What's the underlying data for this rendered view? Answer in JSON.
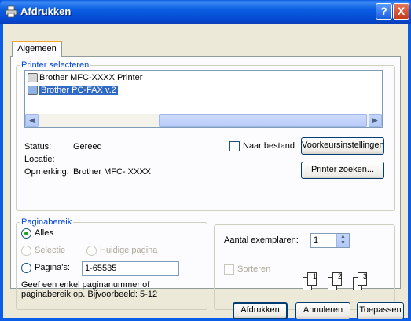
{
  "window": {
    "title": "Afdrukken",
    "help_glyph": "?",
    "close_glyph": "X"
  },
  "tabs": [
    {
      "label": "Algemeen"
    }
  ],
  "printer_group": {
    "legend": "Printer selecteren",
    "printers": [
      {
        "name": "Brother MFC-XXXX  Printer",
        "selected": false
      },
      {
        "name": "Brother PC-FAX v.2",
        "selected": true
      }
    ],
    "scroll_left": "◀",
    "scroll_right": "▶",
    "status_label": "Status:",
    "status_value": "Gereed",
    "location_label": "Locatie:",
    "location_value": "",
    "comment_label": "Opmerking:",
    "comment_value": "Brother MFC- XXXX",
    "print_to_file_label": "Naar bestand",
    "print_to_file_checked": false,
    "preferences_button": "Voorkeursinstellingen",
    "find_printer_button": "Printer zoeken..."
  },
  "page_range": {
    "legend": "Paginabereik",
    "all_label": "Alles",
    "selection_label": "Selectie",
    "current_page_label": "Huidige pagina",
    "pages_label": "Pagina's:",
    "pages_value": "1-65535",
    "help_line1": "Geef een enkel paginanummer of",
    "help_line2": "paginabereik op. Bijvoorbeeld: 5-12",
    "selected": "all"
  },
  "copies": {
    "count_label": "Aantal exemplaren:",
    "count_value": "1",
    "spin_up": "▲",
    "spin_down": "▼",
    "collate_label": "Sorteren",
    "collate_checked": false,
    "page_icons": [
      "1",
      "1",
      "2",
      "2",
      "3",
      "3"
    ]
  },
  "footer": {
    "print_button": "Afdrukken",
    "cancel_button": "Annuleren",
    "apply_button": "Toepassen"
  }
}
